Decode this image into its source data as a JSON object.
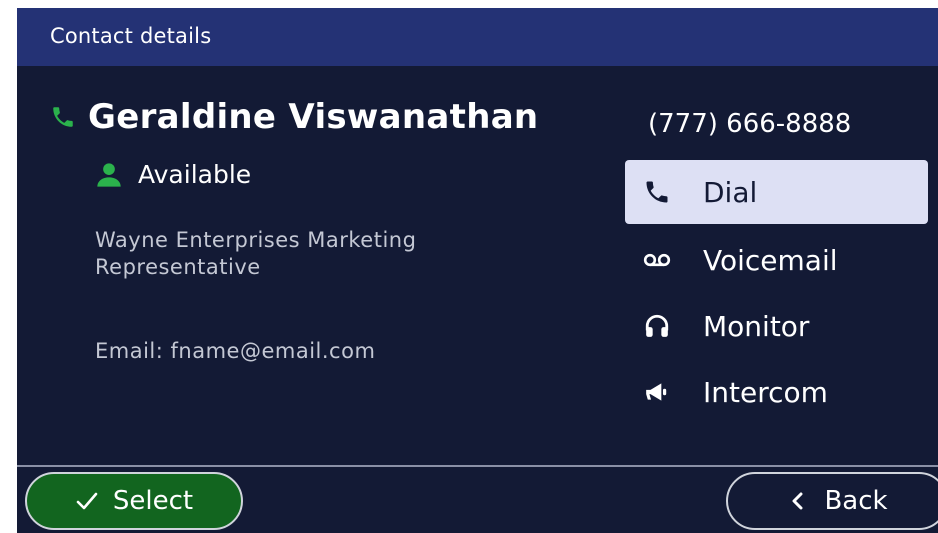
{
  "header": {
    "title": "Contact details"
  },
  "contact": {
    "name": "Geraldine Viswanathan",
    "status": "Available",
    "title": "Wayne Enterprises Marketing Representative",
    "email": "Email: fname@email.com",
    "phone": "(777) 666-8888"
  },
  "actions": [
    {
      "label": "Dial",
      "icon": "phone-icon",
      "selected": true
    },
    {
      "label": "Voicemail",
      "icon": "voicemail-icon",
      "selected": false
    },
    {
      "label": "Monitor",
      "icon": "headphones-icon",
      "selected": false
    },
    {
      "label": "Intercom",
      "icon": "megaphone-icon",
      "selected": false
    }
  ],
  "footer": {
    "select_label": "Select",
    "back_label": "Back"
  },
  "colors": {
    "background": "#131a35",
    "header": "#243275",
    "available_green": "#2bb24c",
    "select_button": "#12651f",
    "selected_row": "#dde0f4"
  }
}
